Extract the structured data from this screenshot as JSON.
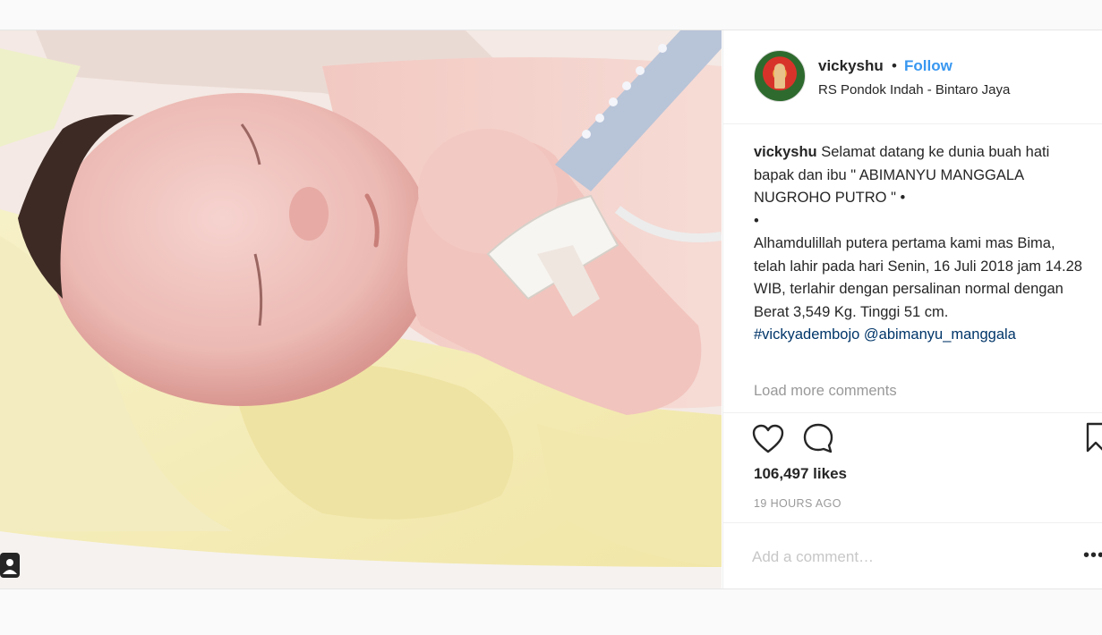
{
  "post": {
    "username": "vickyshu",
    "separator": "•",
    "follow_label": "Follow",
    "location": "RS Pondok Indah - Bintaro Jaya",
    "caption": {
      "username": "vickyshu",
      "line1": "Selamat datang ke dunia buah hati bapak dan ibu \" ABIMANYU MANGGALA NUGROHO PUTRO \" •",
      "line2": "•",
      "line3": "Alhamdulillah putera pertama kami mas Bima, telah lahir pada hari Senin, 16 Juli 2018 jam 14.28 WIB, terlahir dengan persalinan normal dengan Berat 3,549 Kg. Tinggi 51 cm.",
      "hashtag": "#vickyadembojo",
      "mention": "@abimanyu_manggala"
    },
    "load_more_label": "Load more comments",
    "likes": "106,497 likes",
    "time_ago": "19 HOURS AGO",
    "comment_placeholder": "Add a comment…",
    "more_options": "•••"
  },
  "icons": {
    "like": "heart-outline-icon",
    "comment": "speech-bubble-icon",
    "save": "bookmark-icon",
    "user_tag": "person-tag-icon",
    "more": "ellipsis-icon"
  },
  "colors": {
    "link_blue": "#3897f0",
    "hashtag_blue": "#003569",
    "muted": "#999999"
  }
}
